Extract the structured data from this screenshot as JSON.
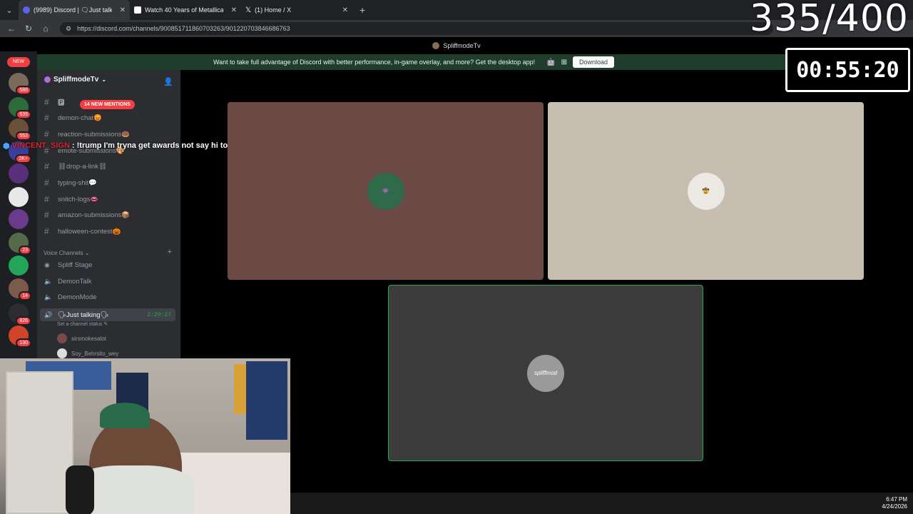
{
  "browser": {
    "tabs": [
      {
        "label": "(9989) Discord | 🗨Just talkin...",
        "favicon_color": "#5865f2"
      },
      {
        "label": "Watch 40 Years of Metallica, Night...",
        "favicon_color": "#ffffff"
      },
      {
        "label": "(1) Home / X",
        "favicon_color": "#000000"
      }
    ],
    "url": "https://discord.com/channels/900851711860703263/901220703846686763",
    "new_tab_icon": "plus-icon"
  },
  "discord": {
    "window_title": "SpliffmodeTv",
    "banner": {
      "text": "Want to take full advantage of Discord with better performance, in-game overlay, and more? Get the desktop app!",
      "download_label": "Download"
    },
    "rail": {
      "new_label": "NEW",
      "servers": [
        {
          "badge": "588",
          "color": "#7a6a5a"
        },
        {
          "badge": "639",
          "color": "#2e6b3a"
        },
        {
          "badge": "553",
          "color": "#6a5038"
        },
        {
          "badge": "2K+",
          "color": "#3b3f9a"
        },
        {
          "badge": "",
          "color": "#5a2f7a"
        },
        {
          "badge": "",
          "color": "#e8e8e8"
        },
        {
          "badge": "",
          "color": "#6b3a8a"
        },
        {
          "badge": "23",
          "color": "#556a4a"
        },
        {
          "badge": "",
          "color": "#23a55a"
        },
        {
          "badge": "14",
          "color": "#7a5a4a"
        },
        {
          "badge": "826",
          "color": "#2b2d31"
        },
        {
          "badge": "130",
          "color": "#d0442a"
        }
      ]
    },
    "server_name": "SpliffmodeTv",
    "new_mentions": "14 NEW MENTIONS",
    "text_channels": [
      "🅿",
      "demon-chat😡",
      "reaction-submissions🍩",
      "emote-submissions🎨",
      "⛓drop-a-link⛓",
      "typing-shit💬",
      "snitch-logs👄",
      "amazon-submissions📦",
      "halloween-contest🎃"
    ],
    "voice_category": "Voice Channels",
    "voice_channels": [
      {
        "name": "Spliff Stage",
        "icon": "stage-icon"
      },
      {
        "name": "DemonTalk",
        "icon": "speaker-icon"
      },
      {
        "name": "DemonMode",
        "icon": "speaker-icon"
      },
      {
        "name": "🗣Just talking🗣",
        "icon": "speaker-icon",
        "timer": "2:29:27"
      }
    ],
    "channel_status": "Set a channel status",
    "members": [
      "sirsmokesalot",
      "Soy_Behrsito_wey"
    ],
    "call_tiles": [
      {
        "bg": "#6b4a46",
        "avatar_color": "#2f6a4a"
      },
      {
        "bg": "#c7bdb0",
        "avatar_color": "#d9d6d0"
      },
      {
        "bg": "#3c3c3c",
        "avatar_color": "#9a9a9a",
        "avatar_text": "spliffmod"
      }
    ]
  },
  "chat_overlay": {
    "user": "VINCENT_SIGN",
    "message": ": !trump I'm tryna get awards not say hi to fuckers"
  },
  "stream_overlay": {
    "counter": "335/400",
    "clock": "00:55:20"
  },
  "taskbar": {
    "time": "6:47 PM",
    "date": "4/24/2026"
  }
}
